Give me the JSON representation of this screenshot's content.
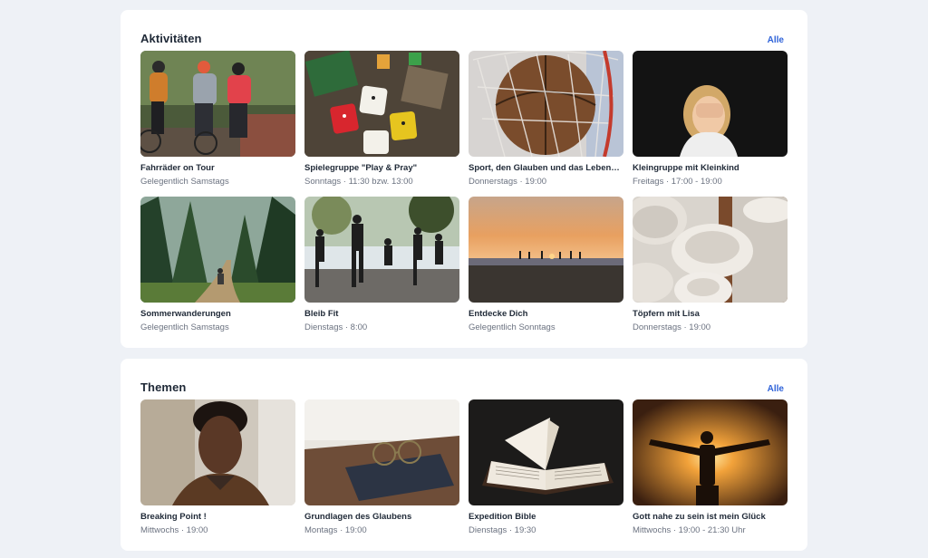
{
  "sections": [
    {
      "title": "Aktivitäten",
      "all_label": "Alle",
      "items": [
        {
          "title": "Fahrräder on Tour",
          "subtitle": "Gelegentlich Samstags"
        },
        {
          "title": "Spielegruppe \"Play & Pray\"",
          "subtitle": "Sonntags · 11:30 bzw. 13:00"
        },
        {
          "title": "Sport, den Glauben und das Leben…",
          "subtitle": "Donnerstags · 19:00"
        },
        {
          "title": "Kleingruppe mit Kleinkind",
          "subtitle": "Freitags · 17:00 - 19:00"
        },
        {
          "title": "Sommerwanderungen",
          "subtitle": "Gelegentlich Samstags"
        },
        {
          "title": "Bleib Fit",
          "subtitle": "Dienstags · 8:00"
        },
        {
          "title": "Entdecke Dich",
          "subtitle": "Gelegentlich Sonntags"
        },
        {
          "title": "Töpfern mit Lisa",
          "subtitle": "Donnerstags · 19:00"
        }
      ]
    },
    {
      "title": "Themen",
      "all_label": "Alle",
      "items": [
        {
          "title": "Breaking Point !",
          "subtitle": "Mittwochs · 19:00"
        },
        {
          "title": "Grundlagen des Glaubens",
          "subtitle": "Montags · 19:00"
        },
        {
          "title": "Expedition Bible",
          "subtitle": "Dienstags · 19:30"
        },
        {
          "title": "Gott nahe zu sein ist mein Glück",
          "subtitle": "Mittwochs · 19:00 - 21:30 Uhr"
        }
      ]
    }
  ]
}
